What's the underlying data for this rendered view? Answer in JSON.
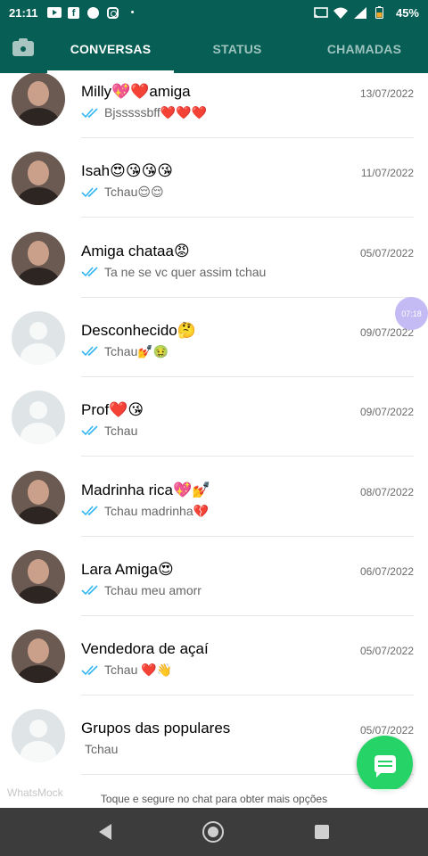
{
  "status_bar": {
    "time": "21:11",
    "battery_percent": "45%",
    "dot": "•",
    "app_icons": [
      "youtube-icon",
      "facebook-icon",
      "messenger-icon",
      "instagram-icon"
    ],
    "system_icons": [
      "cast-icon",
      "wifi-icon",
      "signal-icon",
      "battery-icon"
    ]
  },
  "app_bar": {
    "tabs": [
      {
        "label": "CONVERSAS",
        "active": true
      },
      {
        "label": "STATUS",
        "active": false
      },
      {
        "label": "CHAMADAS",
        "active": false
      }
    ],
    "camera_icon": "camera-icon"
  },
  "chats": [
    {
      "name": "Milly💖❤️amiga",
      "date": "13/07/2022",
      "message": "Bjsssssbff❤️❤️❤️",
      "read": true,
      "avatar": "photo"
    },
    {
      "name": "Isah😍😘😘😘",
      "date": "11/07/2022",
      "message": "Tchau😌😌",
      "read": true,
      "avatar": "photo"
    },
    {
      "name": "Amiga chataa😡",
      "date": "05/07/2022",
      "message": "Ta ne se vc quer assim tchau",
      "read": true,
      "avatar": "photo"
    },
    {
      "name": "Desconhecido🤔",
      "date": "09/07/2022",
      "message": "Tchau💅🤢",
      "read": true,
      "avatar": "default"
    },
    {
      "name": "Prof❤️😘",
      "date": "09/07/2022",
      "message": "Tchau",
      "read": true,
      "avatar": "default"
    },
    {
      "name": "Madrinha rica💖💅",
      "date": "08/07/2022",
      "message": "Tchau madrinha💔",
      "read": true,
      "avatar": "photo"
    },
    {
      "name": "Lara Amiga😍",
      "date": "06/07/2022",
      "message": "Tchau meu amorr",
      "read": true,
      "avatar": "photo"
    },
    {
      "name": "Vendedora de açaí",
      "date": "05/07/2022",
      "message": "Tchau ❤️👋",
      "read": true,
      "avatar": "photo"
    },
    {
      "name": "Grupos das populares",
      "date": "05/07/2022",
      "message": "Tchau",
      "read": false,
      "avatar": "default"
    }
  ],
  "floating_bubble": {
    "text": "07:18"
  },
  "fab": {
    "icon": "new-chat-icon"
  },
  "hint": {
    "text": "Toque e segure no chat para obter mais opções"
  },
  "watermark": {
    "text": "WhatsMock"
  },
  "nav_bar": {
    "icons": [
      "back-icon",
      "home-icon",
      "recents-icon"
    ]
  },
  "colors": {
    "primary": "#075e54",
    "accent": "#25d366",
    "tick_blue": "#34b7f1"
  }
}
